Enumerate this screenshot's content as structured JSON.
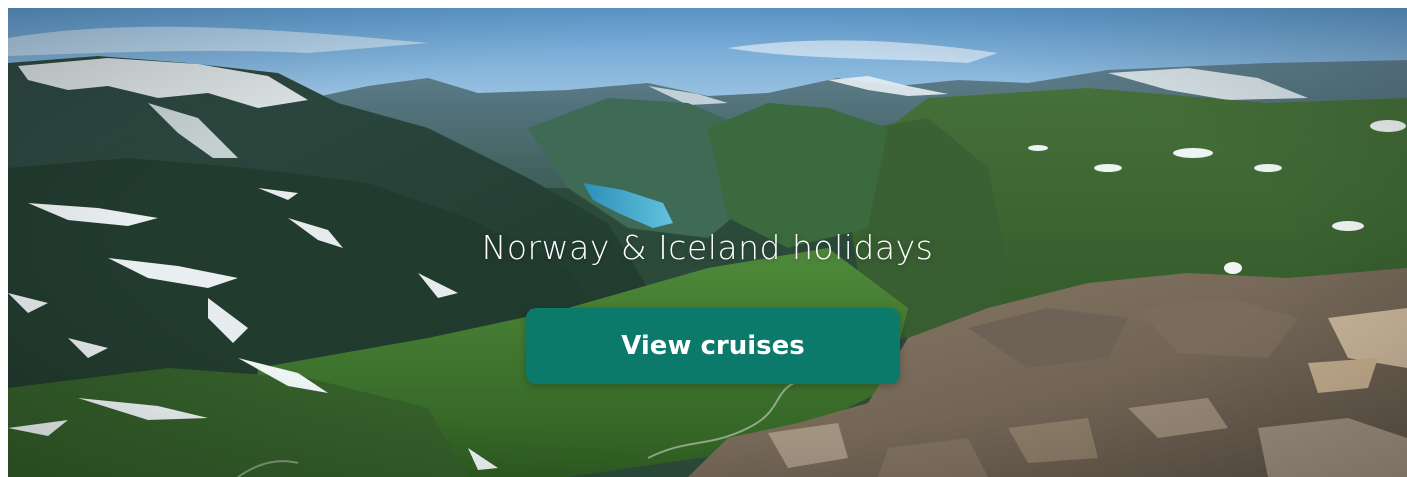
{
  "hero": {
    "headline": "Norway & Iceland holidays",
    "cta_label": "View cruises",
    "image_subject": "fjord-mountain-landscape",
    "colors": {
      "cta_background": "#0b7a6b",
      "headline_text": "#ffffff",
      "sky": "#7fb0d8",
      "fjord_water": "#3a9fc4",
      "valley_green": "#3f7a32"
    }
  }
}
